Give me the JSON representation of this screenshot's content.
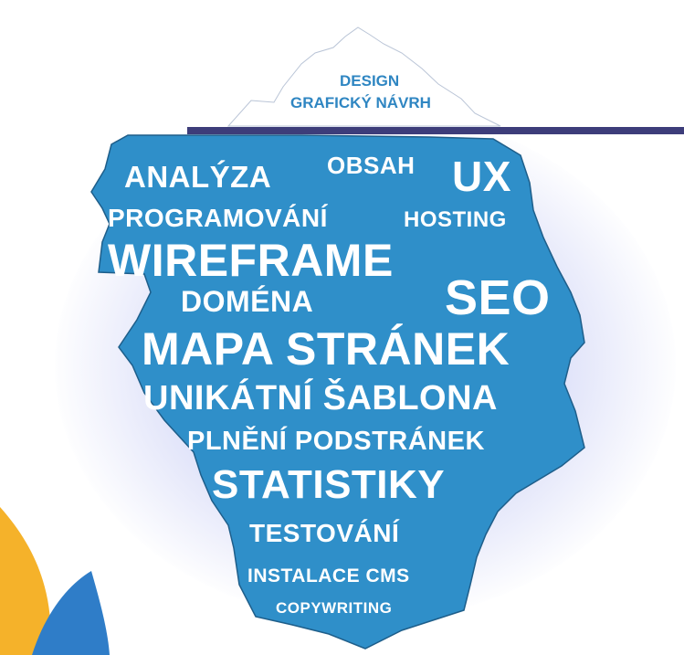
{
  "tip": {
    "line1": "DESIGN",
    "line2": "GRAFICKÝ NÁVRH"
  },
  "words": {
    "analyza": "ANALÝZA",
    "obsah": "OBSAH",
    "ux": "UX",
    "programovani": "PROGRAMOVÁNÍ",
    "hosting": "HOSTING",
    "wireframe": "WIREFRAME",
    "domena": "DOMÉNA",
    "seo": "SEO",
    "mapa": "MAPA STRÁNEK",
    "sablona": "UNIKÁTNÍ ŠABLONA",
    "plneni": "PLNĚNÍ PODSTRÁNEK",
    "statistiky": "STATISTIKY",
    "testovani": "TESTOVÁNÍ",
    "instalace": "INSTALACE CMS",
    "copywriting": "COPYWRITING"
  },
  "colors": {
    "iceberg": "#2f8fc9",
    "waterline": "#3d3d7a",
    "tip_text": "#2f86c2",
    "word_text": "#ffffff",
    "accent_orange": "#f5b22a",
    "accent_blue": "#2f7dc8"
  }
}
